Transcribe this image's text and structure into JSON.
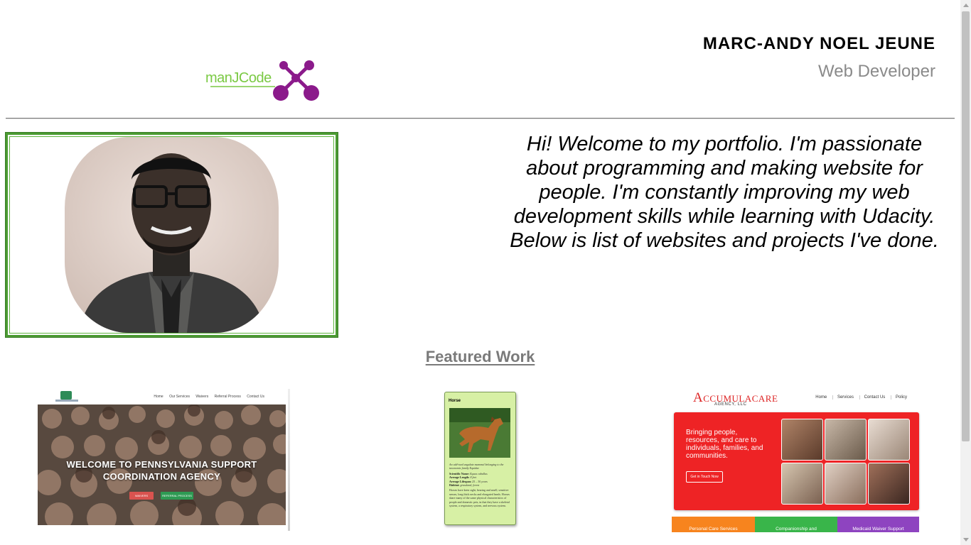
{
  "header": {
    "logo_text": "manJCode",
    "name": "MARC-ANDY NOEL JEUNE",
    "role": "Web Developer"
  },
  "hero": {
    "intro": "Hi! Welcome to my portfolio. I'm passionate about programming and making website for people. I'm constantly improving my web development skills while learning with Udacity. Below is list of websites and projects I've done."
  },
  "featured": {
    "title": "Featured Work",
    "projects": [
      {
        "nav": [
          "Home",
          "Our Services",
          "Waivers",
          "Referral Process",
          "Contact Us"
        ],
        "headline_line1": "WELCOME TO PENNSYLVANIA SUPPORT",
        "headline_line2": "COORDINATION AGENCY",
        "button_a": "WAIVERS",
        "button_b": "REFERRAL PROCESS"
      },
      {
        "title": "Horse",
        "intro": "An odd-toed ungulate mammal belonging to the taxonomic family Equidae",
        "facts": [
          {
            "label": "Scientific Name:",
            "value": "Equus caballus"
          },
          {
            "label": "Average Length:",
            "value": "8 feet"
          },
          {
            "label": "Average Lifespan:",
            "value": "25 – 30 years"
          },
          {
            "label": "Habitat:",
            "value": "grassland, forest"
          }
        ],
        "body": "Horses have keen sight, hearing and smell, sensitive senses, long thick necks and elongated heads. Horses share many of the same physical characteristics of people and domestic pets, in that they have a skeletal system, a respiratory system, and nervous system."
      },
      {
        "logo_a": "A",
        "logo_b": "CCUMULA",
        "logo_c": "CARE",
        "logo_sub": "AGENCY, LLC",
        "nav": [
          "Home",
          "Services",
          "Contact Us",
          "Policy"
        ],
        "tagline": "Bringing people, resources, and care to individuals, families, and communities.",
        "button": "Get in Touch Now",
        "tiles": [
          "Personal Care Services",
          "Companionship and",
          "Medicaid Waiver Support"
        ]
      }
    ]
  },
  "colors": {
    "frame_green": "#4b9a32",
    "logo_green": "#7ac943",
    "logo_purple": "#8b1a8b",
    "accent_red": "#ee2325"
  }
}
